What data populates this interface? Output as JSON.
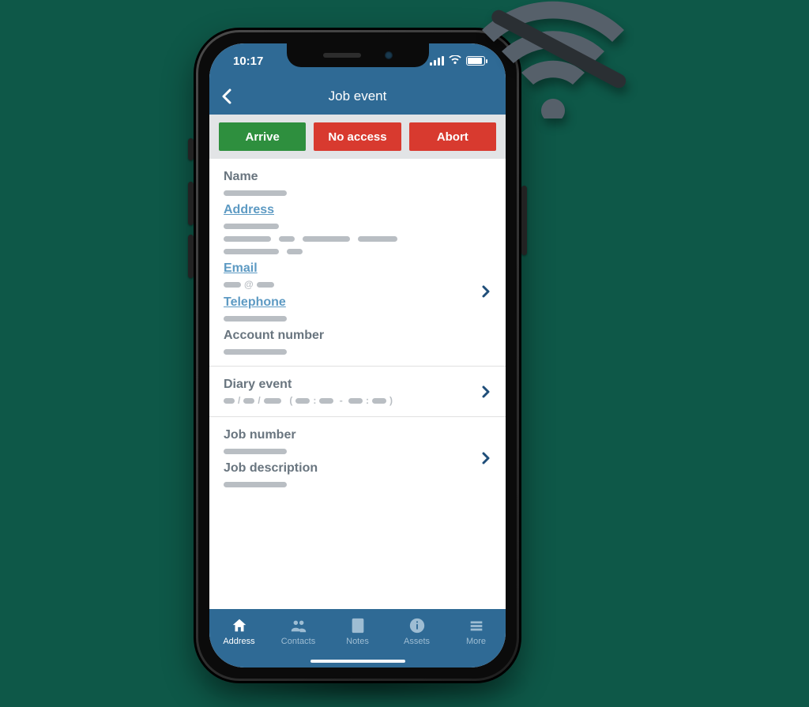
{
  "colors": {
    "brand": "#2f6a95",
    "arrive": "#2e8f3e",
    "danger": "#d83a2f",
    "link": "#5d9ac3",
    "muted": "#69757f"
  },
  "status": {
    "time": "10:17"
  },
  "nav": {
    "title": "Job event"
  },
  "actions": {
    "arrive": "Arrive",
    "no_access": "No access",
    "abort": "Abort"
  },
  "fields": {
    "name_label": "Name",
    "address_label": "Address",
    "email_label": "Email",
    "telephone_label": "Telephone",
    "account_number_label": "Account number",
    "diary_event_label": "Diary event",
    "job_number_label": "Job number",
    "job_description_label": "Job description"
  },
  "tabs": {
    "address": "Address",
    "contacts": "Contacts",
    "notes": "Notes",
    "assets": "Assets",
    "more": "More"
  },
  "icons": {
    "overlay": "wifi-off-icon"
  }
}
